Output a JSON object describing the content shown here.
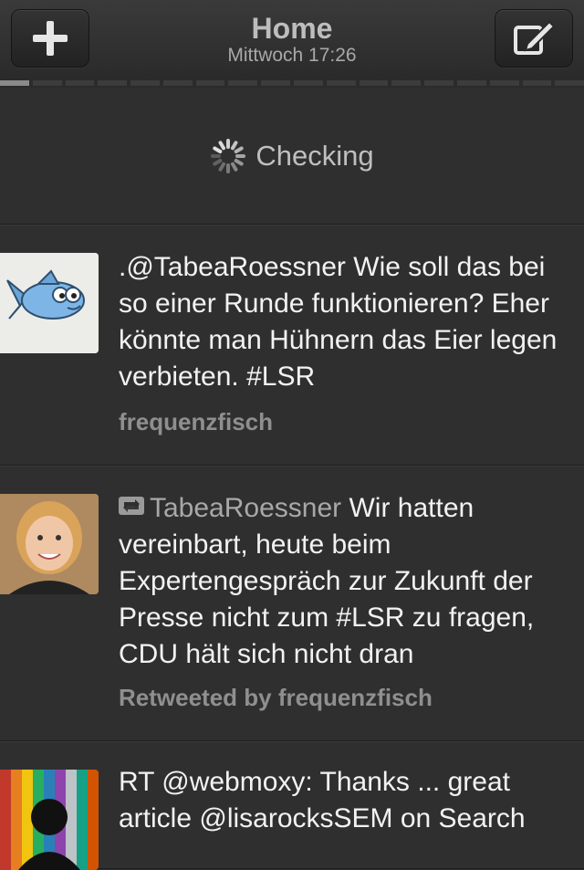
{
  "header": {
    "title": "Home",
    "subtitle": "Mittwoch 17:26",
    "left_icon": "plus-icon",
    "right_icon": "compose-icon"
  },
  "checking": {
    "label": "Checking",
    "icon": "spinner-icon"
  },
  "tweets": [
    {
      "text": ".@TabeaRoessner Wie soll das bei so einer Runde funktionieren? Eher könnte man Hühnern das Eier legen verbieten. #LSR",
      "meta": "frequenzfisch",
      "avatar": "fish-avatar"
    },
    {
      "retweet_icon": "retweet-icon",
      "author": "TabeaRoessner",
      "text": "Wir hatten vereinbart, heute beim Expertengespräch zur Zukunft der Presse nicht zum #LSR zu fragen, CDU hält sich nicht dran",
      "meta": "Retweeted by frequenzfisch",
      "avatar": "woman-avatar"
    },
    {
      "text": "RT @webmoxy: Thanks ... great article @lisarocksSEM on Search",
      "avatar": "silhouette-avatar"
    }
  ],
  "colors": {
    "background": "#2f2f2f",
    "text": "#f2f2f2",
    "meta": "#8f8f8f"
  }
}
